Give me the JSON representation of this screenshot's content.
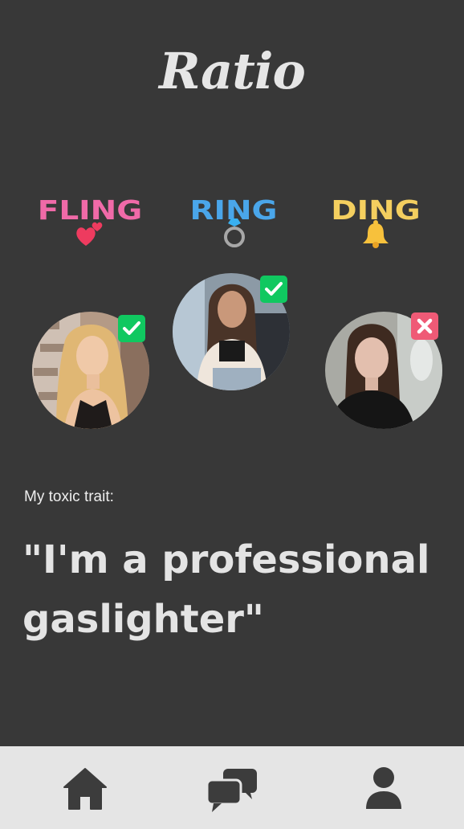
{
  "app": {
    "title": "Ratio"
  },
  "categories": [
    {
      "label": "FLING",
      "icon": "hearts-icon",
      "color": "#f06aa8"
    },
    {
      "label": "RING",
      "icon": "ring-icon",
      "color": "#4aa6ea"
    },
    {
      "label": "DING",
      "icon": "bell-icon",
      "color": "#f4cf5f"
    }
  ],
  "profiles": [
    {
      "photo": "woman-blonde-photo",
      "status": "check-icon",
      "status_color": "#10c860"
    },
    {
      "photo": "woman-white-jacket-photo",
      "status": "check-icon",
      "status_color": "#10c860"
    },
    {
      "photo": "woman-dark-hair-photo",
      "status": "x-icon",
      "status_color": "#ef5a76"
    }
  ],
  "trait": {
    "label": "My toxic trait:",
    "quote": "\"I'm a professional gaslighter\""
  },
  "nav": [
    {
      "icon": "home-icon"
    },
    {
      "icon": "chat-icon"
    },
    {
      "icon": "profile-icon"
    }
  ]
}
